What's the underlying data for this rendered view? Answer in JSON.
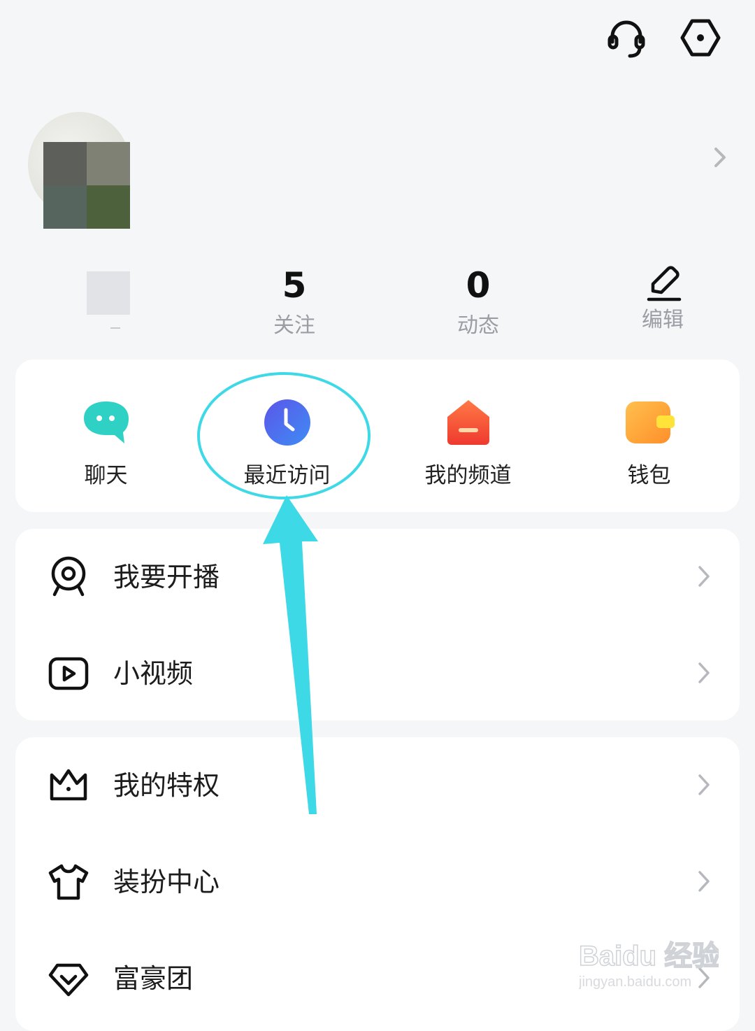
{
  "top_bar": {
    "icons": [
      "headset-icon",
      "settings-hexagon-icon"
    ]
  },
  "profile": {
    "avatar": "avatar (pixelated)",
    "chevron": "chevron-right-icon"
  },
  "stats": [
    {
      "value": "5",
      "label": "关注"
    },
    {
      "value": "0",
      "label": "动态"
    }
  ],
  "edit": {
    "label": "编辑",
    "icon": "pen-edit-icon"
  },
  "quick_actions": [
    {
      "label": "聊天",
      "icon": "chat-bubble-icon",
      "color": "#2fd1c4"
    },
    {
      "label": "最近访问",
      "icon": "clock-icon",
      "color": "#4f6ff2"
    },
    {
      "label": "我的频道",
      "icon": "channel-house-icon",
      "color": "#f25a3c"
    },
    {
      "label": "钱包",
      "icon": "wallet-icon",
      "color": "#ffaa33"
    }
  ],
  "menu_group_1": [
    {
      "label": "我要开播",
      "icon": "webcam-icon"
    },
    {
      "label": "小视频",
      "icon": "play-video-icon"
    }
  ],
  "menu_group_2": [
    {
      "label": "我的特权",
      "icon": "crown-icon"
    },
    {
      "label": "装扮中心",
      "icon": "tshirt-icon"
    },
    {
      "label": "富豪团",
      "icon": "diamond-icon"
    }
  ],
  "annotation": {
    "color": "#3dd9e6"
  },
  "watermark": {
    "line1": "Baidu 经验",
    "line2": "jingyan.baidu.com"
  }
}
